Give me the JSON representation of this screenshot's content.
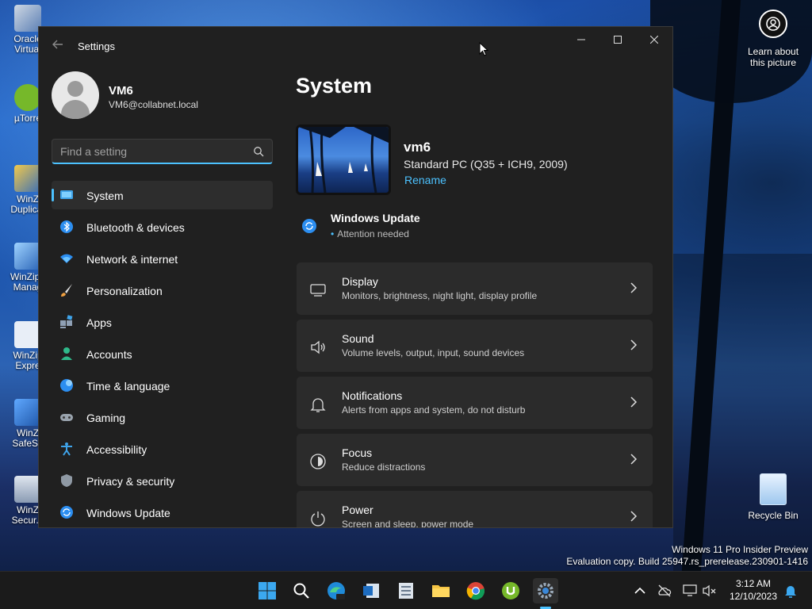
{
  "desktop": {
    "icons": [
      {
        "label": "Oracle\nVirtual"
      },
      {
        "label": "µTorre"
      },
      {
        "label": "WinZ\nDuplicat"
      },
      {
        "label": "WinZip I\nManag"
      },
      {
        "label": "WinZip\nExpre"
      },
      {
        "label": "WinZ\nSafeSh"
      },
      {
        "label": "WinZ\nSecur..."
      }
    ],
    "learn_about": "Learn about this picture",
    "recycle_bin": "Recycle Bin",
    "watermark_line1": "Windows 11 Pro Insider Preview",
    "watermark_line2": "Evaluation copy. Build 25947.rs_prerelease.230901-1416"
  },
  "window": {
    "title": "Settings",
    "user": {
      "name": "VM6",
      "email": "VM6@collabnet.local"
    },
    "search": {
      "placeholder": "Find a setting"
    },
    "nav": [
      {
        "label": "System",
        "icon": "system-icon",
        "active": true
      },
      {
        "label": "Bluetooth & devices",
        "icon": "bluetooth-icon"
      },
      {
        "label": "Network & internet",
        "icon": "wifi-icon"
      },
      {
        "label": "Personalization",
        "icon": "brush-icon"
      },
      {
        "label": "Apps",
        "icon": "apps-icon"
      },
      {
        "label": "Accounts",
        "icon": "person-icon"
      },
      {
        "label": "Time & language",
        "icon": "globe-icon"
      },
      {
        "label": "Gaming",
        "icon": "gamepad-icon"
      },
      {
        "label": "Accessibility",
        "icon": "accessibility-icon"
      },
      {
        "label": "Privacy & security",
        "icon": "shield-icon"
      },
      {
        "label": "Windows Update",
        "icon": "update-icon"
      }
    ],
    "page_title": "System",
    "device": {
      "name": "vm6",
      "model": "Standard PC (Q35 + ICH9, 2009)",
      "rename": "Rename"
    },
    "windows_update": {
      "title": "Windows Update",
      "status": "Attention needed"
    },
    "cards": [
      {
        "title": "Display",
        "subtitle": "Monitors, brightness, night light, display profile",
        "icon": "display-icon"
      },
      {
        "title": "Sound",
        "subtitle": "Volume levels, output, input, sound devices",
        "icon": "speaker-icon"
      },
      {
        "title": "Notifications",
        "subtitle": "Alerts from apps and system, do not disturb",
        "icon": "bell-icon"
      },
      {
        "title": "Focus",
        "subtitle": "Reduce distractions",
        "icon": "focus-icon"
      },
      {
        "title": "Power",
        "subtitle": "Screen and sleep, power mode",
        "icon": "power-icon"
      }
    ]
  },
  "taskbar": {
    "clock": {
      "time": "3:12 AM",
      "date": "12/10/2023"
    },
    "apps": [
      "start-icon",
      "search-icon",
      "edge-icon",
      "outlook-icon",
      "winzip-icon",
      "file-explorer-icon",
      "chrome-icon",
      "utorrent-icon",
      "settings-icon"
    ]
  },
  "colors": {
    "accent": "#4cc2ff",
    "window_bg": "#202020",
    "card_bg": "#2b2b2b",
    "taskbar_bg": "#1b1b1b"
  }
}
